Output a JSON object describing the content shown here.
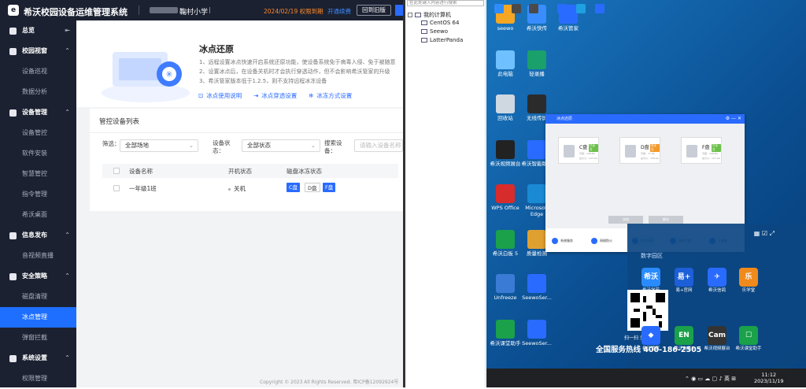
{
  "app": {
    "logo": "logo",
    "title": "希沃校园设备运维管理系统",
    "school": "鞠村小学",
    "expire": "2024/02/19 权限到期",
    "renew": "开通续费",
    "old_version": "回到旧版"
  },
  "sidebar": {
    "items": [
      {
        "label": "总览",
        "type": "group",
        "icon": "home-icon",
        "arrow": "⇤"
      },
      {
        "label": "校园视窗",
        "type": "group",
        "icon": "campus-icon",
        "arrow": "⌃"
      },
      {
        "label": "设备巡视",
        "type": "sub"
      },
      {
        "label": "数据分析",
        "type": "sub"
      },
      {
        "label": "设备管理",
        "type": "group",
        "icon": "device-icon",
        "arrow": "⌃"
      },
      {
        "label": "设备管控",
        "type": "sub"
      },
      {
        "label": "软件安装",
        "type": "sub"
      },
      {
        "label": "智慧管控",
        "type": "sub"
      },
      {
        "label": "指令管理",
        "type": "sub"
      },
      {
        "label": "希沃桌面",
        "type": "sub"
      },
      {
        "label": "信息发布",
        "type": "group",
        "icon": "publish-icon",
        "arrow": "⌃"
      },
      {
        "label": "音视频直播",
        "type": "sub"
      },
      {
        "label": "安全策略",
        "type": "group",
        "icon": "shield-icon",
        "arrow": "⌃"
      },
      {
        "label": "磁盘清理",
        "type": "sub"
      },
      {
        "label": "冰点管理",
        "type": "sub",
        "active": true
      },
      {
        "label": "弹窗拦截",
        "type": "sub"
      },
      {
        "label": "系统设置",
        "type": "group",
        "icon": "settings-icon",
        "arrow": "⌃"
      },
      {
        "label": "权限管理",
        "type": "sub"
      }
    ]
  },
  "hero": {
    "title": "冰点还原",
    "desc": [
      "1、远程设置冰点快速开启系统还原功能，使设备系统免于病毒入侵、免于被随意",
      "2、设置冰点后，在设备关机时才会执行穿透动作，但不会影响希沃管家的升级",
      "3、希沃管家版本低于1.2.5，则不支持远程冰冻设备"
    ],
    "links": [
      "冰点使用说明",
      "冰点穿透设置",
      "冰冻方式设置"
    ]
  },
  "card": {
    "title": "管控设备列表",
    "filter_label": "筛选：",
    "filter_value": "全部场地",
    "status_label": "设备状态：",
    "status_value": "全部状态",
    "search_label": "搜索设备：",
    "search_placeholder": "请输入设备名称",
    "headers": [
      "设备名称",
      "开机状态",
      "磁盘冰冻状态"
    ],
    "rows": [
      {
        "name": "一年级1班",
        "power": "关机",
        "disks": [
          "C盘",
          "D盘",
          "F盘"
        ]
      }
    ]
  },
  "copyright": "Copyright © 2023 All Rights Reserved. 粤ICP备12092924号",
  "tree": {
    "search": "在此处键入内容进行搜索",
    "root": "我的计算机",
    "nodes": [
      "CentOS 64",
      "Seewo",
      "LatterPanda"
    ]
  },
  "desktop": {
    "icons": [
      "seewo",
      "希沃快传",
      "希沃管家",
      "此电脑",
      "轻录播",
      "回收站",
      "无线传屏",
      "希沃视频展台",
      "希沃智能助手",
      "WPS Office",
      "Microsoft Edge",
      "希沃白板 5",
      "质量检测",
      "Unfreeze",
      "SeewoSer...",
      "希沃课堂助手",
      "SeewoSer..."
    ],
    "clock": {
      "time": "11:12",
      "date": "2023/11/19"
    },
    "lang": "英"
  },
  "freeze_window": {
    "title": "冰点还原",
    "disks": [
      {
        "name": "C盘",
        "tag": "已冰冻",
        "tagcolor": "#6cc04a",
        "size": "可用：108.8G",
        "total": "总大小：127.0G"
      },
      {
        "name": "D盘",
        "tag": "未冰冻",
        "tagcolor": "#f39a2b",
        "size": "可用：77.3G",
        "total": "总大小：108.0G"
      },
      {
        "name": "F盘",
        "tag": "已冰冻",
        "tagcolor": "#6cc04a",
        "size": "可用：108.8G",
        "total": "总大小：127.0G"
      }
    ],
    "buttons": [
      "冻结",
      "解冻"
    ],
    "tabs": [
      "系统服务",
      "网络防火",
      "冰点还原",
      "弹窗拦截",
      "工具箱"
    ]
  },
  "popup": {
    "title": "数字园区",
    "scan": "扫一扫 关注服务",
    "hotline": "全国服务热线 400-186-2505",
    "apps": [
      {
        "label": "希沃学苑",
        "bg": "#2a8bff",
        "mark": "希沃"
      },
      {
        "label": "易+官网",
        "bg": "#1d5fd8",
        "mark": "易+"
      },
      {
        "label": "希沃信鸽",
        "bg": "#2a6bff",
        "mark": "✈"
      },
      {
        "label": "乐学堂",
        "bg": "#f08a1c",
        "mark": "乐"
      },
      {
        "label": "希沃管家",
        "bg": "#2a6bff",
        "mark": "◆"
      },
      {
        "label": "希沃白板5",
        "bg": "#1aa14a",
        "mark": "EN"
      },
      {
        "label": "希沃视频展台",
        "bg": "#333333",
        "mark": "Cam"
      },
      {
        "label": "希沃课堂助手",
        "bg": "#1aa14a",
        "mark": "☐"
      }
    ]
  }
}
